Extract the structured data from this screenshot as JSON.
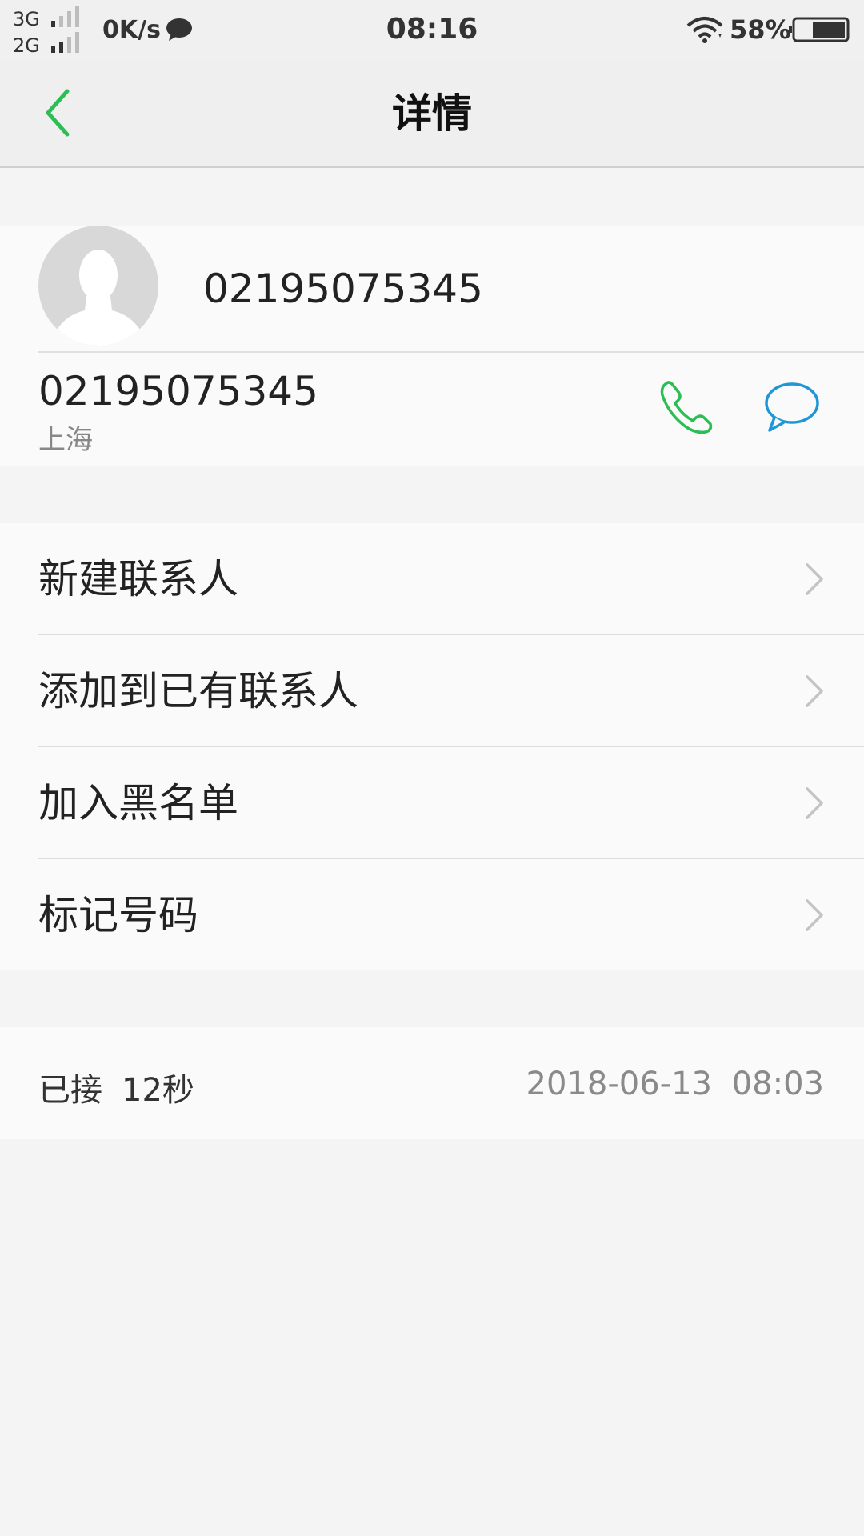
{
  "status_bar": {
    "network_1": "3G",
    "network_2": "2G",
    "speed": "0K/s",
    "time": "08:16",
    "battery_percent": "58%"
  },
  "header": {
    "title": "详情"
  },
  "contact": {
    "name": "02195075345",
    "phone_number": "02195075345",
    "location": "上海"
  },
  "actions": [
    {
      "label": "新建联系人"
    },
    {
      "label": "添加到已有联系人"
    },
    {
      "label": "加入黑名单"
    },
    {
      "label": "标记号码"
    }
  ],
  "call_log": {
    "status": "已接",
    "duration": "12秒",
    "datetime": "2018-06-13 08:03"
  },
  "colors": {
    "accent_green": "#2cbd55",
    "message_blue": "#2196d6"
  }
}
